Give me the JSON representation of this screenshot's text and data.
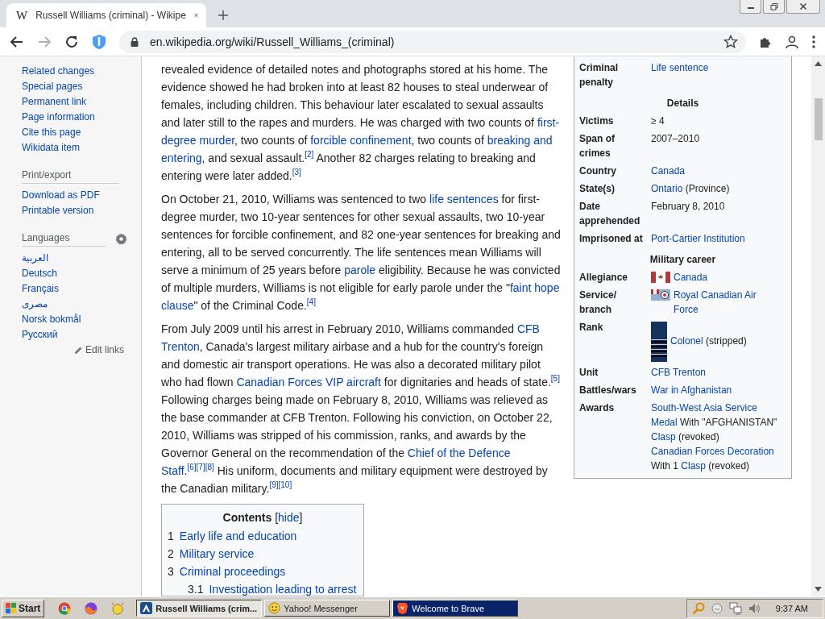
{
  "browser": {
    "tab": {
      "favicon": "W",
      "title": "Russell Williams (criminal) - Wikipe",
      "selected": true
    },
    "forward": {
      "disabled": true
    },
    "url": "en.wikipedia.org/wiki/Russell_Williams_(criminal)"
  },
  "sidebar": {
    "tools": [
      "Related changes",
      "Special pages",
      "Permanent link",
      "Page information",
      "Cite this page",
      "Wikidata item"
    ],
    "print_export": {
      "heading": "Print/export",
      "items": [
        "Download as PDF",
        "Printable version"
      ]
    },
    "languages": {
      "heading": "Languages",
      "items": [
        "العربية",
        "Deutsch",
        "Français",
        "مصرى",
        "Norsk bokmål",
        "Русский"
      ],
      "edit_links": "Edit links"
    }
  },
  "article": {
    "paragraphs": [
      {
        "lines": [
          [
            {
              "kind": "text",
              "text": "revealed evidence of detailed notes and photographs stored at his home. The"
            }
          ],
          [
            {
              "kind": "text",
              "text": "evidence showed he had broken into at least 82 houses to steal underwear of"
            }
          ],
          [
            {
              "kind": "text",
              "text": "females, including children. This behaviour later escalated to sexual assaults"
            }
          ],
          [
            {
              "kind": "text",
              "text": "and later still to the rapes and murders. He was charged with two counts of "
            },
            {
              "kind": "link",
              "text": "first-"
            }
          ],
          [
            {
              "kind": "link",
              "text": "degree murder"
            },
            {
              "kind": "text",
              "text": ", two counts of "
            },
            {
              "kind": "link",
              "text": "forcible confinement"
            },
            {
              "kind": "text",
              "text": ", two counts of "
            },
            {
              "kind": "link",
              "text": "breaking and"
            }
          ],
          [
            {
              "kind": "link",
              "text": "entering"
            },
            {
              "kind": "text",
              "text": ", and sexual assault."
            },
            {
              "kind": "ref",
              "text": "[2]"
            },
            {
              "kind": "text",
              "text": " Another 82 charges relating to breaking and"
            }
          ],
          [
            {
              "kind": "text",
              "text": "entering were later added."
            },
            {
              "kind": "ref",
              "text": "[3]"
            }
          ]
        ]
      },
      {
        "lines": [
          [
            {
              "kind": "text",
              "text": "On October 21, 2010, Williams was sentenced to two "
            },
            {
              "kind": "link",
              "text": "life sentences"
            },
            {
              "kind": "text",
              "text": " for first-"
            }
          ],
          [
            {
              "kind": "text",
              "text": "degree murder, two 10-year sentences for other sexual assaults, two 10-year"
            }
          ],
          [
            {
              "kind": "text",
              "text": "sentences for forcible confinement, and 82 one-year sentences for breaking and"
            }
          ],
          [
            {
              "kind": "text",
              "text": "entering, all to be served concurrently. The life sentences mean Williams will"
            }
          ],
          [
            {
              "kind": "text",
              "text": "serve a minimum of 25 years before "
            },
            {
              "kind": "link",
              "text": "parole"
            },
            {
              "kind": "text",
              "text": " eligibility. Because he was convicted"
            }
          ],
          [
            {
              "kind": "text",
              "text": "of multiple murders, Williams is not eligible for early parole under the \""
            },
            {
              "kind": "link",
              "text": "faint hope"
            }
          ],
          [
            {
              "kind": "link",
              "text": "clause"
            },
            {
              "kind": "text",
              "text": "\" of the Criminal Code."
            },
            {
              "kind": "ref",
              "text": "[4]"
            }
          ]
        ]
      },
      {
        "lines": [
          [
            {
              "kind": "text",
              "text": "From July 2009 until his arrest in February 2010, Williams commanded "
            },
            {
              "kind": "link",
              "text": "CFB"
            }
          ],
          [
            {
              "kind": "link",
              "text": "Trenton"
            },
            {
              "kind": "text",
              "text": ", Canada's largest military airbase and a hub for the country's foreign"
            }
          ],
          [
            {
              "kind": "text",
              "text": "and domestic air transport operations. He was also a decorated military pilot"
            }
          ],
          [
            {
              "kind": "text",
              "text": "who had flown "
            },
            {
              "kind": "link",
              "text": "Canadian Forces VIP aircraft"
            },
            {
              "kind": "text",
              "text": " for dignitaries and heads of state."
            },
            {
              "kind": "ref",
              "text": "[5]"
            }
          ],
          [
            {
              "kind": "text",
              "text": "Following charges being made on February 8, 2010, Williams was relieved as"
            }
          ],
          [
            {
              "kind": "text",
              "text": "the base commander at CFB Trenton. Following his conviction, on October 22,"
            }
          ],
          [
            {
              "kind": "text",
              "text": "2010, Williams was stripped of his commission, ranks, and awards by the"
            }
          ],
          [
            {
              "kind": "text",
              "text": "Governor General on the recommendation of the "
            },
            {
              "kind": "link",
              "text": "Chief of the Defence"
            }
          ],
          [
            {
              "kind": "link",
              "text": "Staff"
            },
            {
              "kind": "text",
              "text": "."
            },
            {
              "kind": "ref",
              "text": "[6]"
            },
            {
              "kind": "ref",
              "text": "[7]"
            },
            {
              "kind": "ref",
              "text": "[8]"
            },
            {
              "kind": "text",
              "text": " His uniform, documents and military equipment were destroyed by"
            }
          ],
          [
            {
              "kind": "text",
              "text": "the Canadian military."
            },
            {
              "kind": "ref",
              "text": "[9]"
            },
            {
              "kind": "ref",
              "text": "[10]"
            }
          ]
        ]
      }
    ]
  },
  "contents": {
    "title": "Contents",
    "toggle_open": "[",
    "toggle": "hide",
    "toggle_close": "]",
    "items": [
      {
        "number": "1",
        "label": "Early life and education"
      },
      {
        "number": "2",
        "label": "Military service"
      },
      {
        "number": "3",
        "label": "Criminal proceedings",
        "children": [
          {
            "number": "3.1",
            "label": "Investigation leading to arrest"
          }
        ]
      }
    ]
  },
  "infobox": {
    "rows": [
      {
        "kind": "row",
        "label": "Criminal\npenalty",
        "value": [
          [
            {
              "kind": "link",
              "text": "Life sentence"
            }
          ]
        ]
      },
      {
        "kind": "header",
        "label": "Details"
      },
      {
        "kind": "row",
        "label": "Victims",
        "value": [
          [
            {
              "kind": "text",
              "text": "≥ 4"
            }
          ]
        ]
      },
      {
        "kind": "row",
        "label": "Span of\ncrimes",
        "value": [
          [
            {
              "kind": "text",
              "text": "2007–2010"
            }
          ]
        ]
      },
      {
        "kind": "row",
        "label": "Country",
        "value": [
          [
            {
              "kind": "link",
              "text": "Canada"
            }
          ]
        ]
      },
      {
        "kind": "row",
        "label": "State(s)",
        "value": [
          [
            {
              "kind": "link",
              "text": "Ontario"
            },
            {
              "kind": "text",
              "text": " (Province)"
            }
          ]
        ]
      },
      {
        "kind": "row",
        "label": "Date\napprehended",
        "value": [
          [
            {
              "kind": "text",
              "text": "February 8, 2010"
            }
          ]
        ]
      },
      {
        "kind": "row",
        "label": "Imprisoned at",
        "value": [
          [
            {
              "kind": "link",
              "text": "Port-Cartier Institution"
            }
          ]
        ]
      },
      {
        "kind": "header",
        "label": "Military career"
      },
      {
        "kind": "flag",
        "label": "Allegiance",
        "value": [
          [
            {
              "kind": "link",
              "text": "Canada"
            }
          ]
        ]
      },
      {
        "kind": "ensign",
        "label": "Service/\nbranch",
        "value": [
          [
            {
              "kind": "link",
              "text": "Royal Canadian Air"
            }
          ],
          [
            {
              "kind": "link",
              "text": "Force"
            }
          ]
        ]
      },
      {
        "kind": "insignia",
        "label": "Rank",
        "value": [
          [
            {
              "kind": "link",
              "text": "Colonel"
            },
            {
              "kind": "text",
              "text": " (stripped)"
            }
          ]
        ]
      },
      {
        "kind": "row",
        "label": "Unit",
        "value": [
          [
            {
              "kind": "link",
              "text": "CFB Trenton"
            }
          ]
        ]
      },
      {
        "kind": "row",
        "label": "Battles/wars",
        "value": [
          [
            {
              "kind": "link",
              "text": "War in Afghanistan"
            }
          ]
        ]
      },
      {
        "kind": "row",
        "label": "Awards",
        "value": [
          [
            {
              "kind": "link",
              "text": "South-West Asia Service"
            }
          ],
          [
            {
              "kind": "link",
              "text": "Medal"
            },
            {
              "kind": "text",
              "text": " With \"AFGHANISTAN\""
            }
          ],
          [
            {
              "kind": "link",
              "text": "Clasp"
            },
            {
              "kind": "text",
              "text": " (revoked)"
            }
          ],
          [
            {
              "kind": "link",
              "text": "Canadian Forces Decoration"
            }
          ],
          [
            {
              "kind": "text",
              "text": "With 1 "
            },
            {
              "kind": "link",
              "text": "Clasp"
            },
            {
              "kind": "text",
              "text": " (revoked)"
            }
          ]
        ]
      }
    ]
  },
  "taskbar": {
    "start": "Start",
    "tasks": [
      {
        "label": "Russell Williams (crim...",
        "selected": true,
        "flashing": false
      },
      {
        "label": "Yahoo! Messenger",
        "selected": false,
        "flashing": false
      },
      {
        "label": "Welcome to Brave",
        "selected": false,
        "flashing": true
      }
    ],
    "time": "9:37 AM"
  }
}
